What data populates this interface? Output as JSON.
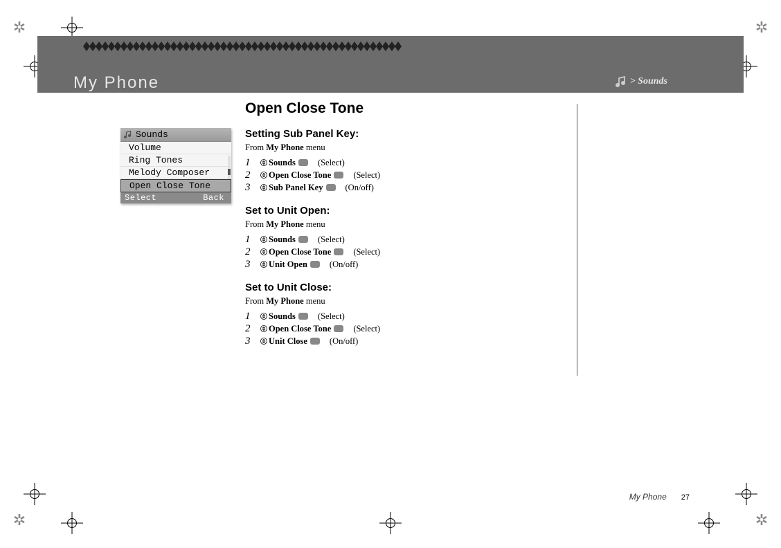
{
  "header": {
    "title": "My Phone",
    "breadcrumb": "> Sounds"
  },
  "phone_screen": {
    "title": "Sounds",
    "items": [
      "Volume",
      "Ring Tones",
      "Melody Composer",
      "Open Close Tone"
    ],
    "selected_index": 3,
    "soft_left": "Select",
    "soft_right": "Back"
  },
  "content": {
    "page_title": "Open Close Tone",
    "sections": [
      {
        "heading": "Setting Sub Panel Key:",
        "from_prefix": "From ",
        "from_bold": "My Phone",
        "from_suffix": " menu",
        "steps": [
          {
            "num": "1",
            "item": "Sounds",
            "action": "(Select)"
          },
          {
            "num": "2",
            "item": "Open Close Tone",
            "action": "(Select)"
          },
          {
            "num": "3",
            "item": "Sub Panel Key",
            "action": "(On/off)"
          }
        ]
      },
      {
        "heading": "Set to Unit Open:",
        "from_prefix": "From ",
        "from_bold": "My Phone",
        "from_suffix": " menu",
        "steps": [
          {
            "num": "1",
            "item": "Sounds",
            "action": "(Select)"
          },
          {
            "num": "2",
            "item": "Open Close Tone",
            "action": "(Select)"
          },
          {
            "num": "3",
            "item": "Unit Open",
            "action": "(On/off)"
          }
        ]
      },
      {
        "heading": "Set to Unit Close:",
        "from_prefix": "From ",
        "from_bold": "My Phone",
        "from_suffix": " menu",
        "steps": [
          {
            "num": "1",
            "item": "Sounds",
            "action": "(Select)"
          },
          {
            "num": "2",
            "item": "Open Close Tone",
            "action": "(Select)"
          },
          {
            "num": "3",
            "item": "Unit Close",
            "action": "(On/off)"
          }
        ]
      }
    ]
  },
  "footer": {
    "title": "My Phone",
    "page": "27"
  }
}
